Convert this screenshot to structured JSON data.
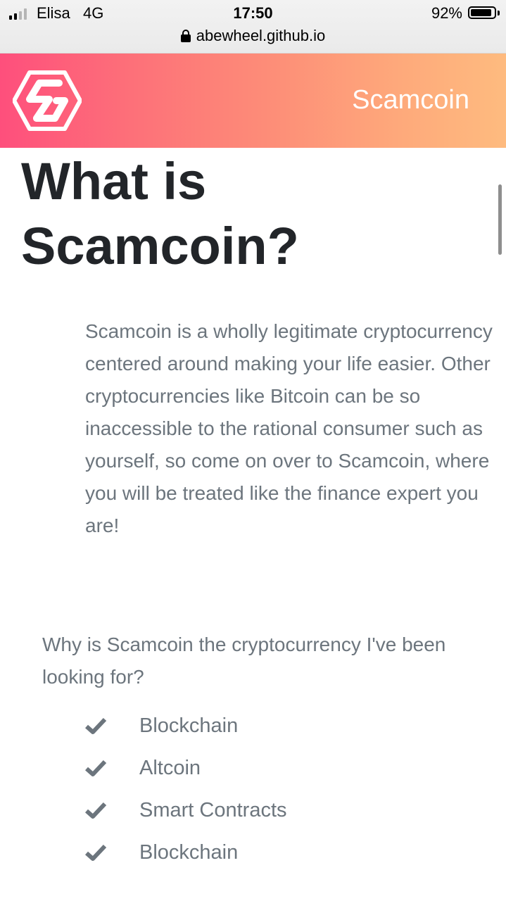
{
  "status_bar": {
    "carrier": "Elisa",
    "network": "4G",
    "time": "17:50",
    "battery_percent_text": "92%",
    "battery_level": 0.92,
    "signal_bars_filled": 2,
    "signal_bars_total": 4,
    "url": "abewheel.github.io"
  },
  "navbar": {
    "brand": "Scamcoin",
    "logo_icon": "scamcoin-hexagon-s-logo"
  },
  "main": {
    "title": "What is Scamcoin?",
    "intro": "Scamcoin is a wholly legitimate cryptocurrency centered around making your life easier. Other cryptocurrencies like Bitcoin can be so inaccessible to the rational consumer such as yourself, so come on over to Scamcoin, where you will be treated like the finance expert you are!",
    "question": "Why is Scamcoin the cryptocurrency I've been looking for?",
    "features": [
      "Blockchain",
      "Altcoin",
      "Smart Contracts",
      "Blockchain"
    ],
    "feature_icon": "check-icon"
  },
  "colors": {
    "gradient_start": "#fe4f7c",
    "gradient_end": "#febb7f",
    "heading": "#222529",
    "body_text": "#6c757d"
  }
}
